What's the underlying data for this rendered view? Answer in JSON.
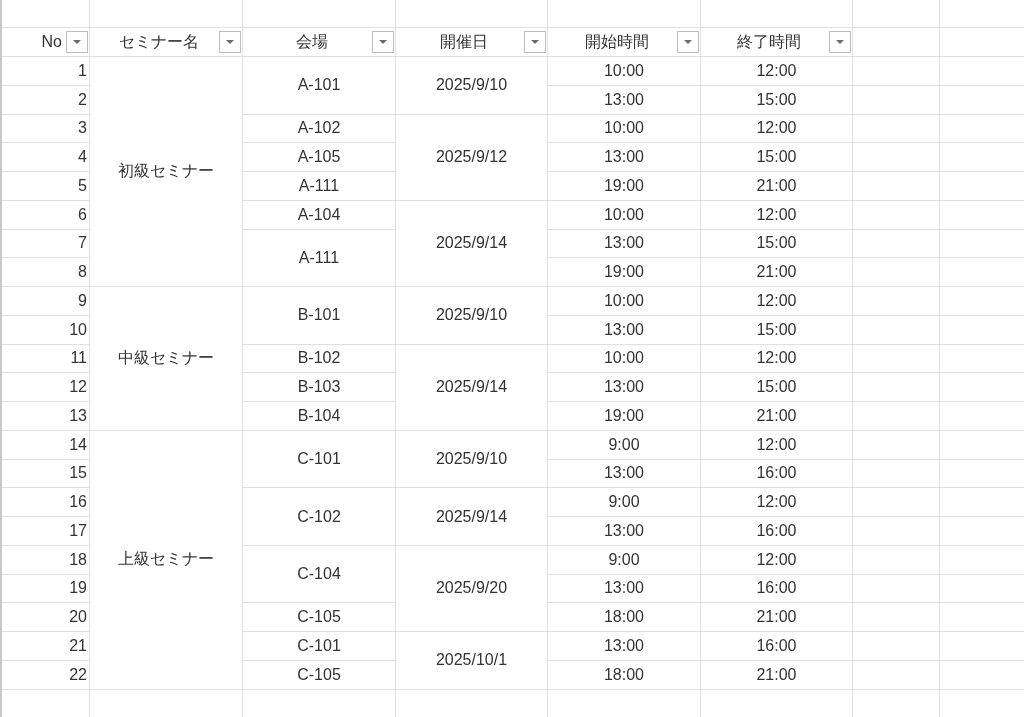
{
  "columns": [
    {
      "label": "No",
      "filter": true
    },
    {
      "label": "セミナー名",
      "filter": true
    },
    {
      "label": "会場",
      "filter": true
    },
    {
      "label": "開催日",
      "filter": true
    },
    {
      "label": "開始時間",
      "filter": true
    },
    {
      "label": "終了時間",
      "filter": true
    }
  ],
  "seminars": [
    {
      "name": "初級セミナー",
      "dates": [
        {
          "date": "2025/9/10",
          "venues": [
            {
              "venue": "A-101",
              "sessions": [
                {
                  "no": "1",
                  "start": "10:00",
                  "end": "12:00"
                },
                {
                  "no": "2",
                  "start": "13:00",
                  "end": "15:00"
                }
              ]
            }
          ]
        },
        {
          "date": "2025/9/12",
          "venues": [
            {
              "venue": "A-102",
              "sessions": [
                {
                  "no": "3",
                  "start": "10:00",
                  "end": "12:00"
                }
              ]
            },
            {
              "venue": "A-105",
              "sessions": [
                {
                  "no": "4",
                  "start": "13:00",
                  "end": "15:00"
                }
              ]
            },
            {
              "venue": "A-111",
              "sessions": [
                {
                  "no": "5",
                  "start": "19:00",
                  "end": "21:00"
                }
              ]
            }
          ]
        },
        {
          "date": "2025/9/14",
          "venues": [
            {
              "venue": "A-104",
              "sessions": [
                {
                  "no": "6",
                  "start": "10:00",
                  "end": "12:00"
                }
              ]
            },
            {
              "venue": "A-111",
              "sessions": [
                {
                  "no": "7",
                  "start": "13:00",
                  "end": "15:00"
                },
                {
                  "no": "8",
                  "start": "19:00",
                  "end": "21:00"
                }
              ]
            }
          ]
        }
      ]
    },
    {
      "name": "中級セミナー",
      "dates": [
        {
          "date": "2025/9/10",
          "venues": [
            {
              "venue": "B-101",
              "sessions": [
                {
                  "no": "9",
                  "start": "10:00",
                  "end": "12:00"
                },
                {
                  "no": "10",
                  "start": "13:00",
                  "end": "15:00"
                }
              ]
            }
          ]
        },
        {
          "date": "2025/9/14",
          "venues": [
            {
              "venue": "B-102",
              "sessions": [
                {
                  "no": "11",
                  "start": "10:00",
                  "end": "12:00"
                }
              ]
            },
            {
              "venue": "B-103",
              "sessions": [
                {
                  "no": "12",
                  "start": "13:00",
                  "end": "15:00"
                }
              ]
            },
            {
              "venue": "B-104",
              "sessions": [
                {
                  "no": "13",
                  "start": "19:00",
                  "end": "21:00"
                }
              ]
            }
          ]
        }
      ]
    },
    {
      "name": "上級セミナー",
      "dates": [
        {
          "date": "2025/9/10",
          "venues": [
            {
              "venue": "C-101",
              "sessions": [
                {
                  "no": "14",
                  "start": "9:00",
                  "end": "12:00"
                },
                {
                  "no": "15",
                  "start": "13:00",
                  "end": "16:00"
                }
              ]
            }
          ]
        },
        {
          "date": "2025/9/14",
          "venues": [
            {
              "venue": "C-102",
              "sessions": [
                {
                  "no": "16",
                  "start": "9:00",
                  "end": "12:00"
                },
                {
                  "no": "17",
                  "start": "13:00",
                  "end": "16:00"
                }
              ]
            }
          ]
        },
        {
          "date": "2025/9/20",
          "venues": [
            {
              "venue": "C-104",
              "sessions": [
                {
                  "no": "18",
                  "start": "9:00",
                  "end": "12:00"
                },
                {
                  "no": "19",
                  "start": "13:00",
                  "end": "16:00"
                }
              ]
            },
            {
              "venue": "C-105",
              "sessions": [
                {
                  "no": "20",
                  "start": "18:00",
                  "end": "21:00"
                }
              ]
            }
          ]
        },
        {
          "date": "2025/10/1",
          "venues": [
            {
              "venue": "C-101",
              "sessions": [
                {
                  "no": "21",
                  "start": "13:00",
                  "end": "16:00"
                }
              ]
            },
            {
              "venue": "C-105",
              "sessions": [
                {
                  "no": "22",
                  "start": "18:00",
                  "end": "21:00"
                }
              ]
            }
          ]
        }
      ]
    }
  ]
}
